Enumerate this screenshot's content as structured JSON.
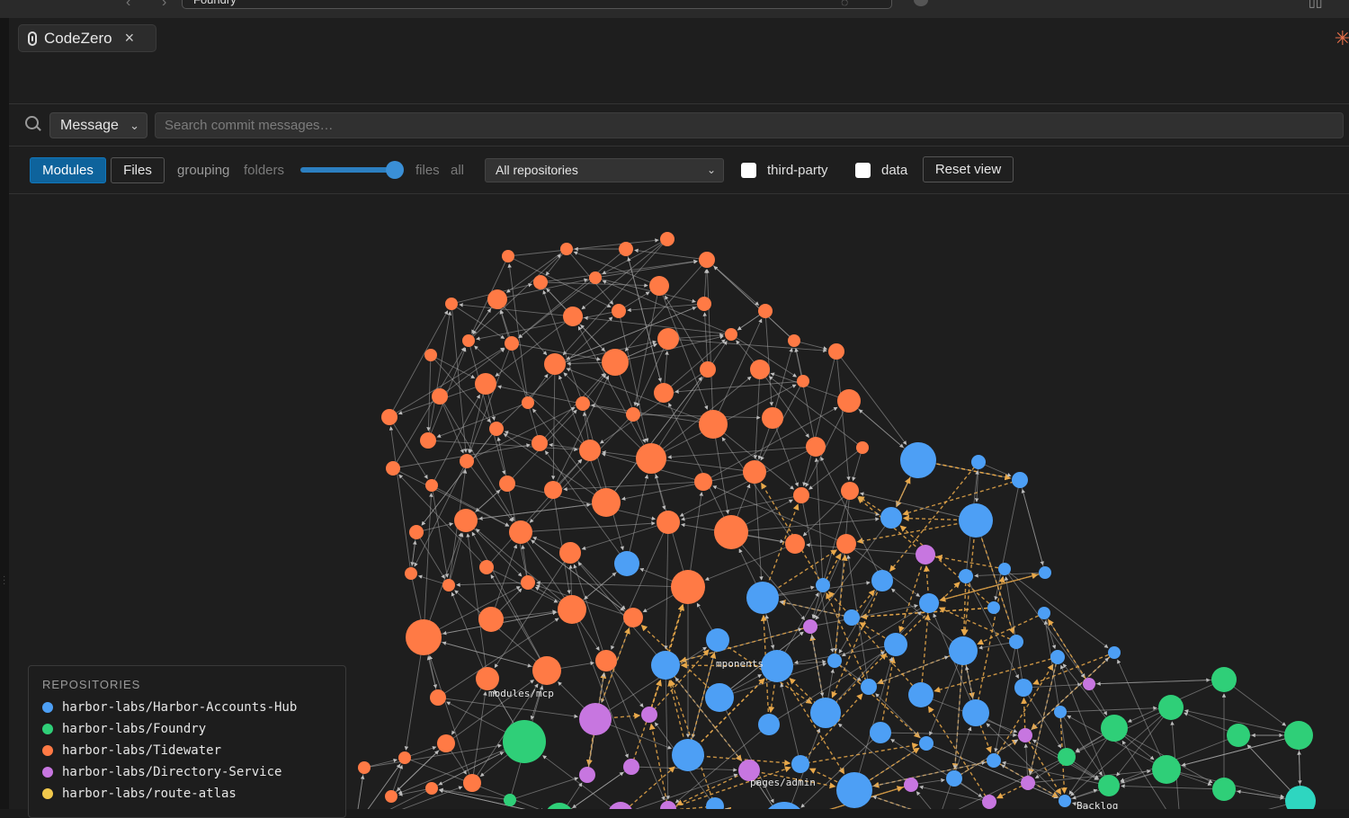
{
  "browser": {
    "url": "Foundry",
    "back_icon": "chevron-left-icon",
    "forward_icon": "chevron-right-icon"
  },
  "tab": {
    "title": "CodeZero",
    "close_symbol": "×"
  },
  "search": {
    "mode_label": "Message",
    "placeholder": "Search commit messages…"
  },
  "toolbar": {
    "modules_label": "Modules",
    "files_label": "Files",
    "grouping_label": "grouping",
    "folders_label": "folders",
    "slider_value": 1.0,
    "files_all_label": "files",
    "all_label": "all",
    "repo_select": "All repositories",
    "third_party_label": "third-party",
    "third_party_checked": false,
    "data_label": "data",
    "data_checked": false,
    "reset_label": "Reset view"
  },
  "graph": {
    "labels": [
      "modules/mcp",
      "mponents",
      "pages/admin",
      "Backlog"
    ]
  },
  "legend": {
    "title": "REPOSITORIES",
    "items": [
      {
        "name": "harbor-labs/Harbor-Accounts-Hub",
        "color": "#4d9ff5"
      },
      {
        "name": "harbor-labs/Foundry",
        "color": "#2fcf78"
      },
      {
        "name": "harbor-labs/Tidewater",
        "color": "#ff7a45"
      },
      {
        "name": "harbor-labs/Directory-Service",
        "color": "#c776e0"
      },
      {
        "name": "harbor-labs/route-atlas",
        "color": "#f2c94c"
      }
    ]
  },
  "colors": {
    "hub": "#4d9ff5",
    "foundry": "#2fcf78",
    "tidewater": "#ff7a45",
    "directory": "#c776e0",
    "route": "#f2c94c",
    "teal": "#2ed6c0",
    "accent": "#0e639c"
  }
}
